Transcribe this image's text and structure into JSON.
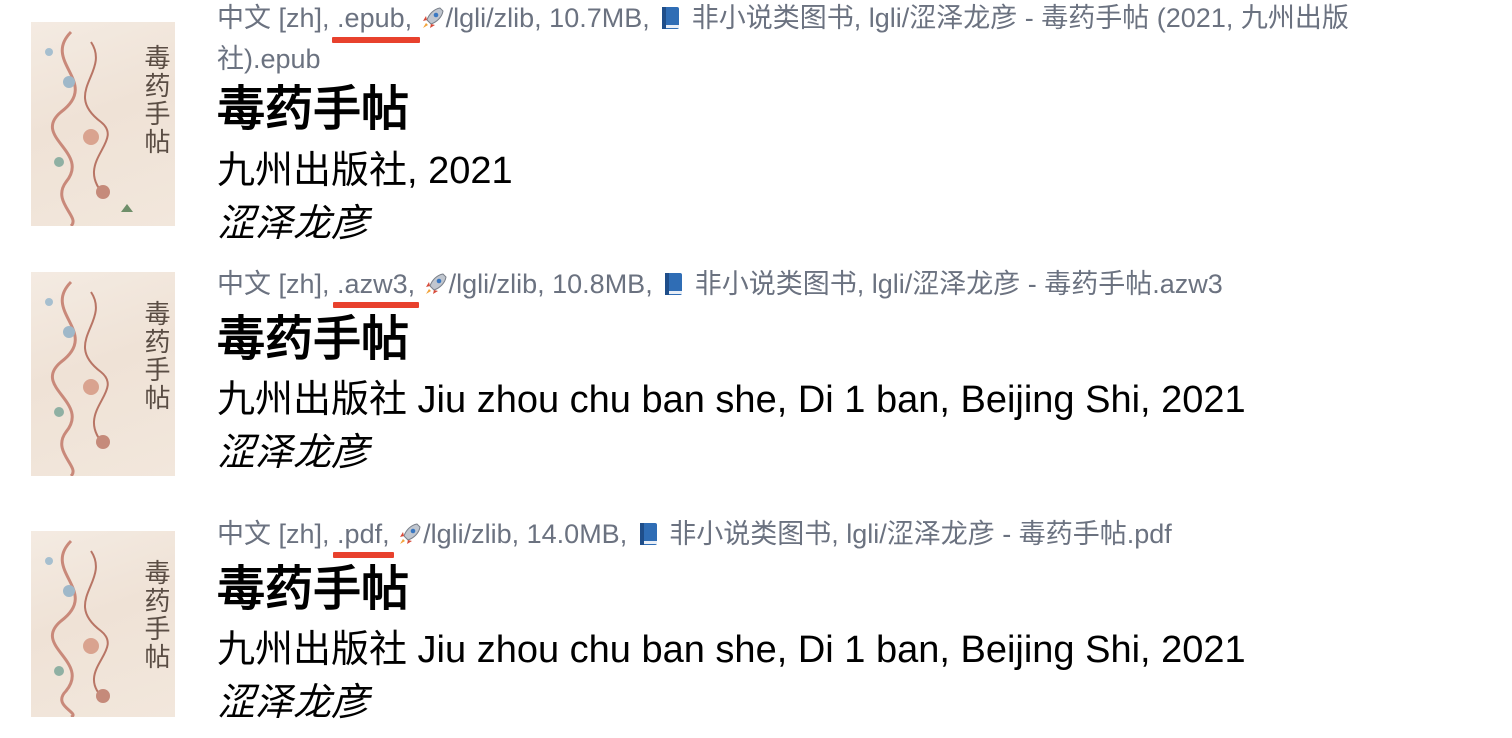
{
  "results": [
    {
      "cover_title": "毒药手帖",
      "meta": {
        "language": "中文 [zh],",
        "extension": ".epub,",
        "source": "/lgli/zlib, 10.7MB,",
        "category": "非小说类图书, lgli/涩泽龙彦 - 毒药手帖 (2021, 九州出版",
        "category_cont": "社).epub"
      },
      "title": "毒药手帖",
      "publisher": "九州出版社, 2021",
      "author": "涩泽龙彦"
    },
    {
      "cover_title": "毒药手帖",
      "meta": {
        "language": "中文 [zh],",
        "extension": ".azw3,",
        "source": "/lgli/zlib, 10.8MB,",
        "category": "非小说类图书, lgli/涩泽龙彦 - 毒药手帖.azw3"
      },
      "title": "毒药手帖",
      "publisher": "九州出版社 Jiu zhou chu ban she, Di 1 ban, Beijing Shi, 2021",
      "author": "涩泽龙彦"
    },
    {
      "cover_title": "毒药手帖",
      "meta": {
        "language": "中文 [zh],",
        "extension": ".pdf,",
        "source": "/lgli/zlib, 14.0MB,",
        "category": "非小说类图书, lgli/涩泽龙彦 - 毒药手帖.pdf"
      },
      "title": "毒药手帖",
      "publisher": "九州出版社 Jiu zhou chu ban she, Di 1 ban, Beijing Shi, 2021",
      "author": "涩泽龙彦"
    }
  ],
  "icons": {
    "rocket": "rocket-icon",
    "book": "blue-book-icon"
  },
  "colors": {
    "meta_text": "#6b7280",
    "highlight_mark": "#e8412d",
    "book_icon": "#2f6db5"
  }
}
